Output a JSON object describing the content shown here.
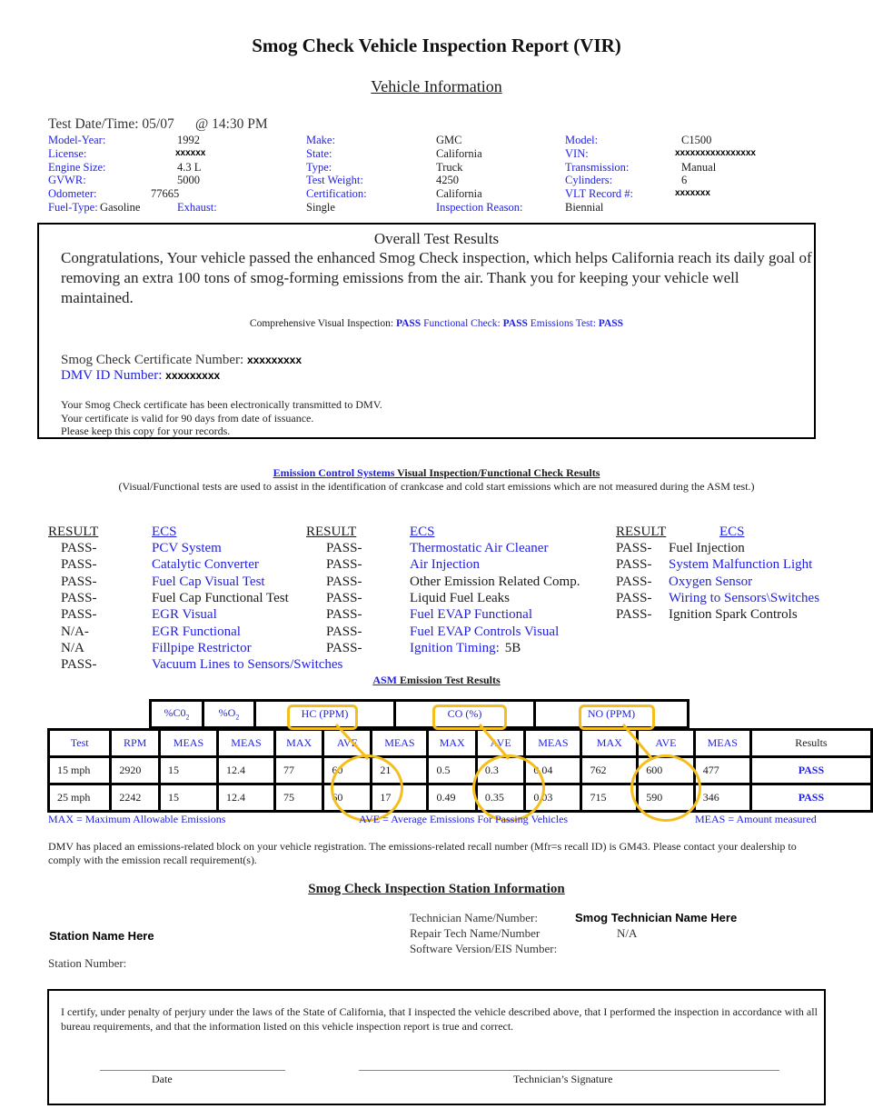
{
  "report": {
    "title": "Smog Check Vehicle Inspection Report (VIR)",
    "vehicle_info_heading": "Vehicle Information",
    "test_datetime": "Test Date/Time: 05/07      @ 14:30 PM"
  },
  "vehicle": {
    "model_year": {
      "label": "Model-Year:",
      "value": "1992"
    },
    "license": {
      "label": "License:",
      "value": "xxxxxx"
    },
    "engine_size": {
      "label": "Engine Size:",
      "value": "4.3 L"
    },
    "gvwr": {
      "label": "GVWR:",
      "value": "5000"
    },
    "odometer": {
      "label": "Odometer:",
      "value": "77665"
    },
    "fuel_type": {
      "label": "Fuel-Type:",
      "value": "Gasoline"
    },
    "make": {
      "label": "Make:",
      "value": "GMC"
    },
    "state": {
      "label": "State:",
      "value": "California"
    },
    "type": {
      "label": "Type:",
      "value": "Truck"
    },
    "test_weight": {
      "label": "Test Weight:",
      "value": "4250"
    },
    "certification": {
      "label": "Certification:",
      "value": "California"
    },
    "exhaust": {
      "label": "Exhaust:",
      "value": "Single"
    },
    "model": {
      "label": "Model:",
      "value": "C1500"
    },
    "vin": {
      "label": "VIN:",
      "value": "xxxxxxxxxxxxxxxx"
    },
    "transmission": {
      "label": "Transmission:",
      "value": "Manual"
    },
    "cylinders": {
      "label": "Cylinders:",
      "value": "6"
    },
    "vlt_record": {
      "label": "VLT Record #:",
      "value": "xxxxxxx"
    },
    "inspection_reason": {
      "label": "Inspection Reason:",
      "value": "Biennial"
    }
  },
  "overall": {
    "title": "Overall Test Results",
    "message": "Congratulations, Your vehicle passed the enhanced Smog Check inspection, which helps California reach its daily goal of removing an extra 100 tons of smog-forming emissions from the air.  Thank you for keeping your vehicle well maintained.",
    "visual_label": "Comprehensive Visual Inspection:",
    "visual_result": "PASS",
    "functional_label": "Functional Check:",
    "functional_result": "PASS",
    "emissions_label": "Emissions Test:",
    "emissions_result": "PASS",
    "cert_label": "Smog Check Certificate Number:",
    "cert_value": "xxxxxxxxx",
    "dmv_label": "DMV ID Number:",
    "dmv_value": "xxxxxxxxx",
    "notes": [
      "Your Smog Check certificate has been electronically transmitted to DMV.",
      "Your certificate is valid for 90 days from date of issuance.",
      "Please keep this copy for your records."
    ]
  },
  "ecs_section": {
    "heading_link": "Emission Control Systems",
    "heading_rest": " Visual Inspection/Functional Check Results",
    "subtitle": "(Visual/Functional tests are used to assist in the identification of crankcase and cold start emissions which are not measured during the ASM test.)",
    "result_header": "RESULT",
    "ecs_header": "ECS",
    "columns": [
      [
        {
          "result": "PASS-",
          "name": "PCV System",
          "link": true
        },
        {
          "result": "PASS-",
          "name": "Catalytic Converter",
          "link": true
        },
        {
          "result": "PASS-",
          "name": "Fuel Cap Visual Test",
          "link": true
        },
        {
          "result": "PASS-",
          "name": "Fuel Cap Functional Test",
          "link": false
        },
        {
          "result": "PASS-",
          "name": "EGR Visual",
          "link": true
        },
        {
          "result": "N/A-",
          "name": "EGR Functional",
          "link": true
        },
        {
          "result": "N/A",
          "name": "Fillpipe Restrictor",
          "link": true
        },
        {
          "result": "PASS-",
          "name": "Vacuum Lines to Sensors/Switches",
          "link": true
        }
      ],
      [
        {
          "result": "PASS-",
          "name": "Thermostatic Air Cleaner",
          "link": true
        },
        {
          "result": "PASS-",
          "name": "Air Injection",
          "link": true
        },
        {
          "result": "PASS-",
          "name": "Other Emission Related Comp.",
          "link": false
        },
        {
          "result": "PASS-",
          "name": "Liquid Fuel Leaks",
          "link": false
        },
        {
          "result": "PASS-",
          "name": "Fuel EVAP Functional",
          "link": true
        },
        {
          "result": "PASS-",
          "name": "Fuel EVAP Controls Visual",
          "link": true
        },
        {
          "result": "PASS-",
          "name": "Ignition Timing:",
          "link": true,
          "extra": "5B"
        }
      ],
      [
        {
          "result": "PASS-",
          "name": "Fuel Injection",
          "link": false
        },
        {
          "result": "PASS-",
          "name": "System Malfunction Light",
          "link": true
        },
        {
          "result": "PASS-",
          "name": "Oxygen Sensor",
          "link": true
        },
        {
          "result": "PASS-",
          "name": "Wiring to Sensors\\Switches",
          "link": true
        },
        {
          "result": "PASS-",
          "name": "Ignition Spark Controls",
          "link": false
        }
      ]
    ]
  },
  "asm": {
    "heading_link": "ASM",
    "heading_rest": " Emission Test Results",
    "group_headers": {
      "co2": "%C0",
      "co2_sub": "2",
      "o2": "%O",
      "o2_sub": "2",
      "hc": "HC (PPM)",
      "co": "CO (%)",
      "no": "NO (PPM)"
    },
    "col_headers": [
      "Test",
      "RPM",
      "MEAS",
      "MEAS",
      "MAX",
      "AVE",
      "MEAS",
      "MAX",
      "AVE",
      "MEAS",
      "MAX",
      "AVE",
      "MEAS",
      "Results"
    ],
    "rows": [
      [
        "15 mph",
        "2920",
        "15",
        "12.4",
        "77",
        "60",
        "21",
        "0.5",
        "0.3",
        "0.04",
        "762",
        "600",
        "477",
        "PASS"
      ],
      [
        "25 mph",
        "2242",
        "15",
        "12.4",
        "75",
        "60",
        "17",
        "0.49",
        "0.35",
        "0.03",
        "715",
        "590",
        "346",
        "PASS"
      ]
    ],
    "legend_max": "MAX = Maximum Allowable Emissions",
    "legend_ave": "AVE = Average Emissions For Passing Vehicles",
    "legend_meas": "MEAS = Amount measured",
    "highlight_color": "#f4be1c"
  },
  "recall_note": "DMV has placed an emissions-related block on your vehicle registration. The emissions-related recall number (Mfr=s recall ID) is GM43.  Please contact your dealership to comply with the emission recall requirement(s).",
  "station": {
    "heading": "Smog Check Inspection Station Information",
    "name": "Station Name Here",
    "number_label": "Station Number:",
    "tech_label": "Technician Name/Number:",
    "tech_value": "Smog Technician Name Here",
    "repair_label": "Repair Tech Name/Number",
    "repair_value": "N/A",
    "software_label": "Software Version/EIS Number:"
  },
  "certification": {
    "statement": "I certify, under penalty of perjury under the laws of the State of California, that I inspected the vehicle described above, that I performed the inspection in accordance with all bureau requirements, and that the information listed on this vehicle inspection report is true and correct.",
    "date_label": "Date",
    "signature_label": "Technician’s Signature"
  },
  "colors": {
    "label_blue": "#1f1fe0",
    "text": "#1a1a1a",
    "highlight": "#f4be1c"
  }
}
